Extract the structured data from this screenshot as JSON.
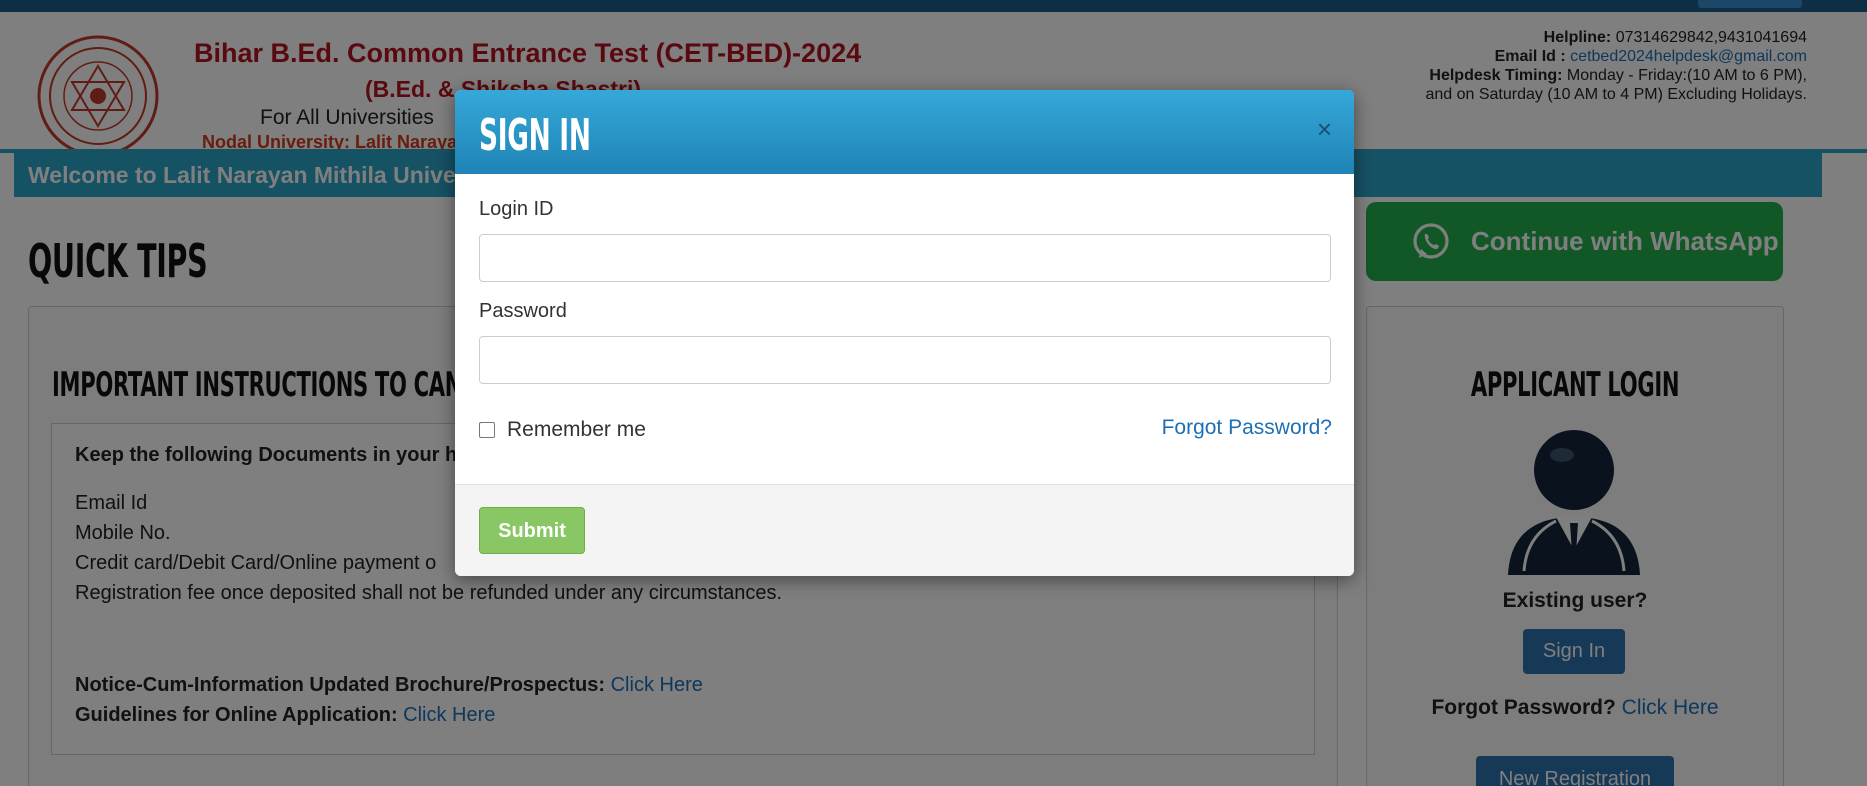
{
  "header": {
    "title": "Bihar B.Ed. Common Entrance Test (CET-BED)-2024",
    "subtitle": "(B.Ed. & Shiksha Shastri)",
    "for_universities": "For All Universities",
    "nodal": "Nodal University: Lalit Narayan",
    "helpline_label": "Helpline:",
    "helpline_value": "07314629842,9431041694",
    "email_label": "Email Id :",
    "email_value": "cetbed2024helpdesk@gmail.com",
    "timing_label": "Helpdesk Timing:",
    "timing_value": "Monday - Friday:(10 AM to 6 PM),",
    "timing_line2": "and on Saturday (10 AM to 4 PM) Excluding Holidays."
  },
  "welcome_text": "Welcome to Lalit Narayan Mithila Univer",
  "quick_tips": "QUICK TIPS",
  "whatsapp": {
    "label": "Continue with WhatsApp",
    "color": "#25b14f"
  },
  "instructions": {
    "title": "IMPORTANT INSTRUCTIONS TO CANDIDA",
    "keep_text": "Keep the following Documents in your ha",
    "documents": [
      "Email Id",
      "Mobile No.",
      "Credit card/Debit Card/Online payment o",
      "Registration fee once deposited shall not be refunded under any circumstances."
    ],
    "notice_label": "Notice-Cum-Information Updated Brochure/Prospectus:",
    "notice_link": "Click Here",
    "guidelines_label": "Guidelines for Online Application:",
    "guidelines_link": "Click Here"
  },
  "applicant_login": {
    "title": "APPLICANT LOGIN",
    "existing_user": "Existing user?",
    "signin_label": "Sign In",
    "forgot_text": "Forgot Password?",
    "forgot_link": "Click Here",
    "new_registration": "New Registration"
  },
  "modal": {
    "title": "SIGN IN",
    "close": "×",
    "login_id_label": "Login ID",
    "login_id_value": "",
    "password_label": "Password",
    "password_value": "",
    "remember_label": "Remember me",
    "remember_checked": false,
    "forgot_password": "Forgot Password?",
    "submit_label": "Submit",
    "submit_color": "#88c763"
  },
  "colors": {
    "header_bar": "#2aa4c9",
    "brand_red": "#b3121e",
    "link": "#1f6fb5",
    "button_blue": "#2f73b0"
  },
  "icons": {
    "seal": "university-seal-icon",
    "whatsapp": "whatsapp-icon",
    "avatar": "user-avatar-icon"
  }
}
